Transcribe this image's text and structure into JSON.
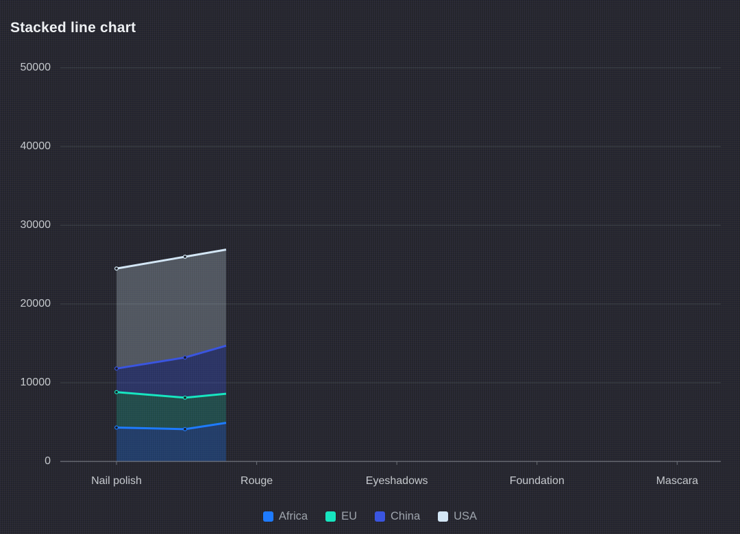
{
  "header": {
    "title": "Stacked line chart"
  },
  "chart_data": {
    "type": "area",
    "stacked": true,
    "title": "Stacked line chart",
    "categories": [
      "Nail polish",
      "Rouge",
      "Eyeshadows",
      "Foundation",
      "Mascara"
    ],
    "xlabel": "",
    "ylabel": "",
    "ylim": [
      0,
      50000
    ],
    "yticks": [
      0,
      10000,
      20000,
      30000,
      40000,
      50000
    ],
    "grid": true,
    "legend_position": "bottom",
    "legend": [
      "Africa",
      "EU",
      "China",
      "USA"
    ],
    "animation_state": "partially drawn: data rendered from 'Nail polish' to ~78% of the way toward 'Rouge'",
    "point_x_fracs": [
      0.0851,
      0.1888,
      0.251
    ],
    "marker_point_indexes": [
      0,
      1
    ],
    "series": [
      {
        "name": "Africa",
        "color": "#1e7bff",
        "fill": "rgba(30,123,255,0.28)",
        "values": [
          4300,
          4100,
          4900
        ],
        "stack_top": [
          4300,
          4100,
          4900
        ]
      },
      {
        "name": "EU",
        "color": "#17e5c0",
        "fill": "rgba(23,229,192,0.20)",
        "values": [
          4500,
          4000,
          3700
        ],
        "stack_top": [
          8800,
          8100,
          8600
        ]
      },
      {
        "name": "China",
        "color": "#3a55e0",
        "fill": "rgba(58,85,224,0.30)",
        "values": [
          3000,
          5100,
          6100
        ],
        "stack_top": [
          11800,
          13200,
          14700
        ]
      },
      {
        "name": "USA",
        "color": "#d3e6f5",
        "fill": "rgba(211,230,245,0.25)",
        "values": [
          12700,
          12800,
          12200
        ],
        "stack_top": [
          24500,
          26000,
          26900
        ]
      }
    ],
    "colors": {
      "background": "#23242c",
      "grid_line": "rgba(180,205,205,0.16)",
      "axis_line": "#85888f",
      "axis_tick": "#6f737b",
      "axis_label": "#c6c9ce",
      "legend_text": "#9ea4ac",
      "title_text": "#eef0f3"
    }
  }
}
